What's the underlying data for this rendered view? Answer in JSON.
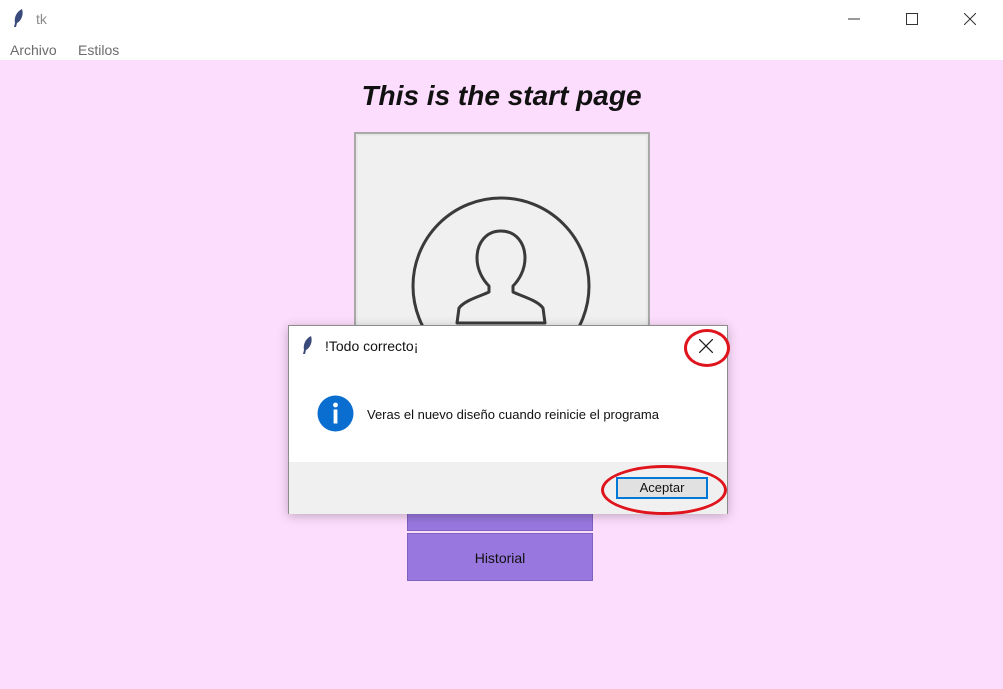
{
  "window": {
    "title": "tk"
  },
  "menu": {
    "items": [
      "Archivo",
      "Estilos"
    ]
  },
  "page": {
    "title": "This is the start page",
    "historial_label": "Historial"
  },
  "dialog": {
    "title": "!Todo correcto¡",
    "message": "Veras el nuevo diseño cuando reinicie el programa",
    "ok_label": "Aceptar",
    "icon": "info-icon"
  },
  "colors": {
    "background": "#fdddfd",
    "button_purple": "#9877de",
    "annotation_red": "#e0141c",
    "info_blue": "#0078d7"
  }
}
